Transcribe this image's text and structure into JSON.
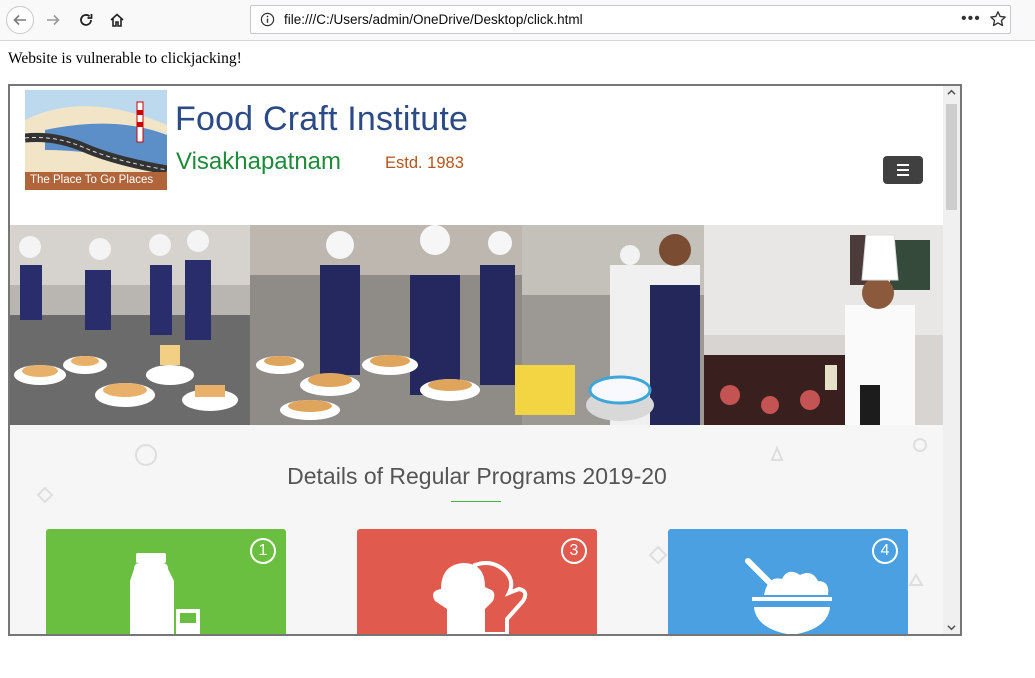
{
  "browser": {
    "url": "file:///C:/Users/admin/OneDrive/Desktop/click.html",
    "more_glyph": "•••"
  },
  "page": {
    "message": "Website is vulnerable to clickjacking!"
  },
  "site": {
    "logo_caption": "The Place To Go Places",
    "name": "Food Craft Institute",
    "city": "Visakhapatnam",
    "estd": "Estd. 1983",
    "section_title": "Details of Regular Programs 2019-20",
    "cards": [
      {
        "number": "1",
        "color": "#6abf40",
        "icon": "milk-bottle-icon"
      },
      {
        "number": "3",
        "color": "#e05a4e",
        "icon": "oven-mitt-icon"
      },
      {
        "number": "4",
        "color": "#4aa0e0",
        "icon": "bowl-icon"
      }
    ]
  },
  "colors": {
    "name": "#2b4a86",
    "city": "#1f8a3a",
    "estd": "#b5541d",
    "accent_line": "#3fba3f"
  }
}
